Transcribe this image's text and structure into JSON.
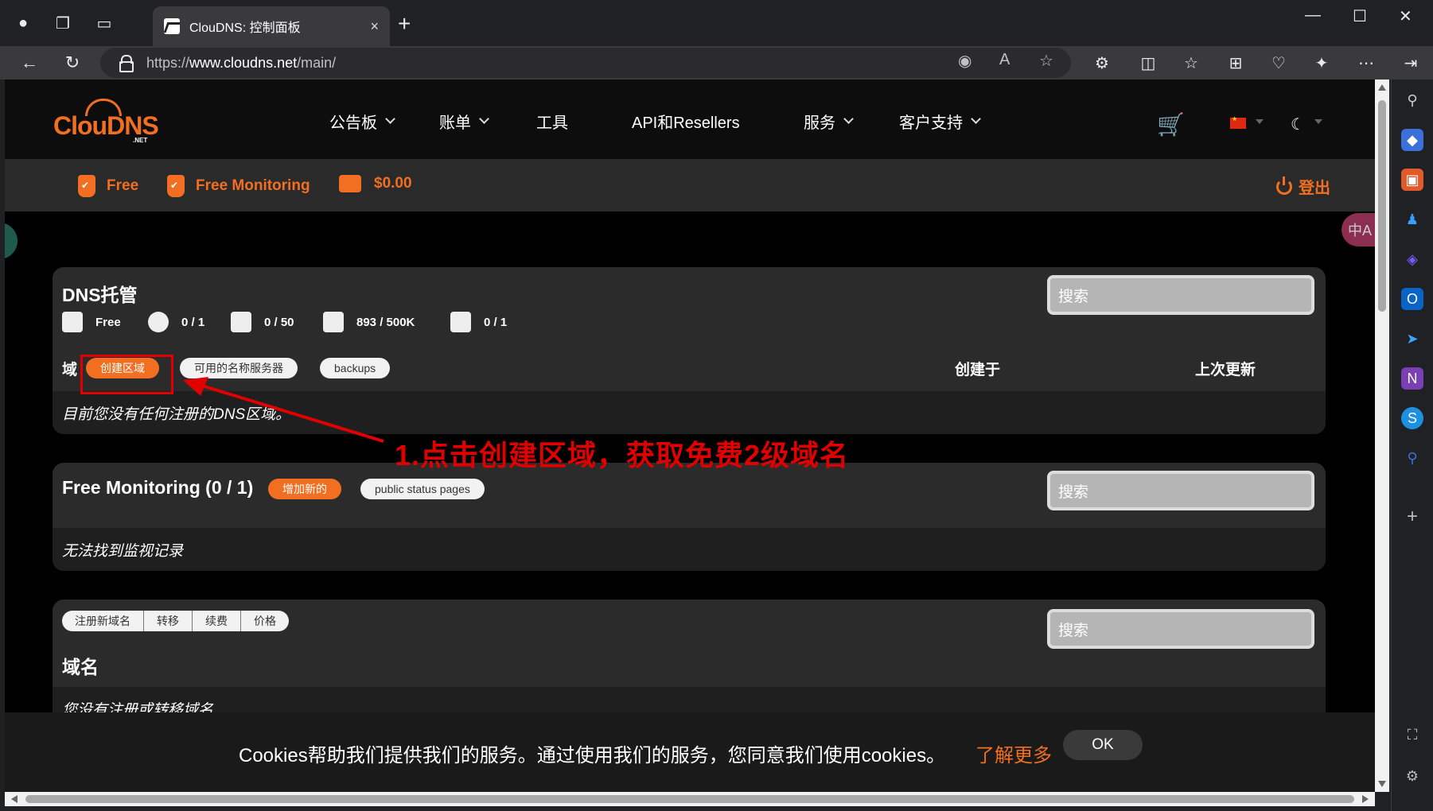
{
  "browser": {
    "tab_title": "ClouDNS: 控制面板",
    "tab_close": "×",
    "new_tab": "+",
    "url_prefix": "https://",
    "url_domain": "www.cloudns.net",
    "url_path": "/main/",
    "window_controls": [
      "—",
      "☐",
      "✕"
    ]
  },
  "site": {
    "logo": "ClouDNS",
    "logo_suffix": ".NET",
    "nav": [
      {
        "label": "公告板",
        "dropdown": true
      },
      {
        "label": "账单",
        "dropdown": true
      },
      {
        "label": "工具",
        "dropdown": false
      },
      {
        "label": "API和Resellers",
        "dropdown": false
      },
      {
        "label": "服务",
        "dropdown": true
      },
      {
        "label": "客户支持",
        "dropdown": true
      }
    ],
    "cart_icon": "🛒",
    "moon_icon": "☾",
    "translate_icon": "中A"
  },
  "subbar": {
    "plan": "Free",
    "monitoring": "Free Monitoring",
    "balance": "$0.00",
    "logout": "登出"
  },
  "dns_panel": {
    "title": "DNS托管",
    "stats": [
      {
        "icon": "plan-icon",
        "value": "Free"
      },
      {
        "icon": "globe-icon",
        "value": "0 / 1"
      },
      {
        "icon": "records-icon",
        "value": "0 / 50"
      },
      {
        "icon": "queries-icon",
        "value": "893 / 500K"
      },
      {
        "icon": "mail-icon",
        "value": "0 / 1"
      }
    ],
    "domain_label": "域",
    "create_zone": "创建区域",
    "available_ns": "可用的名称服务器",
    "backups": "backups",
    "col_created": "创建于",
    "col_updated": "上次更新",
    "empty": "目前您没有任何注册的DNS区域。",
    "search_placeholder": "搜索"
  },
  "monitoring_panel": {
    "title": "Free Monitoring (0 / 1)",
    "add_new": "增加新的",
    "status_pages": "public status pages",
    "empty": "无法找到监视记录",
    "search_placeholder": "搜索"
  },
  "domains_panel": {
    "tabs": [
      "注册新域名",
      "转移",
      "续费",
      "价格"
    ],
    "title": "域名",
    "empty_partial": "您没有注册或转移域名",
    "search_placeholder": "搜索"
  },
  "annotation": {
    "text": "1.点击创建区域，获取免费2级域名",
    "color": "#e00000"
  },
  "cookie": {
    "text": "Cookies帮助我们提供我们的服务。通过使用我们的服务，您同意我们使用cookies。",
    "link": "了解更多",
    "ok": "OK"
  },
  "colors": {
    "accent": "#f26f21",
    "panel": "#2b2b2b",
    "panel_inner": "#1f1f1f"
  }
}
